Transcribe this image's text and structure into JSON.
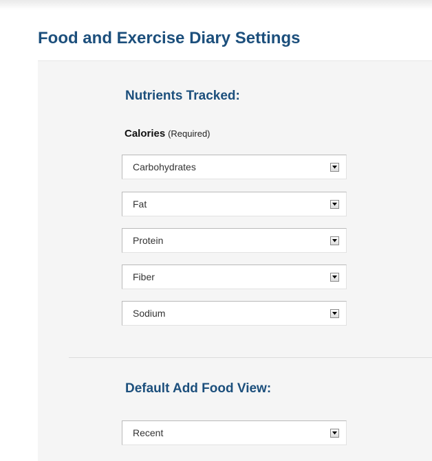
{
  "page": {
    "title": "Food and Exercise Diary Settings"
  },
  "nutrients": {
    "heading": "Nutrients Tracked:",
    "calories_label": "Calories",
    "calories_note": "(Required)",
    "selects": [
      {
        "value": "Carbohydrates"
      },
      {
        "value": "Fat"
      },
      {
        "value": "Protein"
      },
      {
        "value": "Fiber"
      },
      {
        "value": "Sodium"
      }
    ]
  },
  "food_view": {
    "heading": "Default Add Food View:",
    "select": {
      "value": "Recent"
    }
  },
  "icons": {
    "dropdown_arrow": "chevron-down-icon"
  }
}
